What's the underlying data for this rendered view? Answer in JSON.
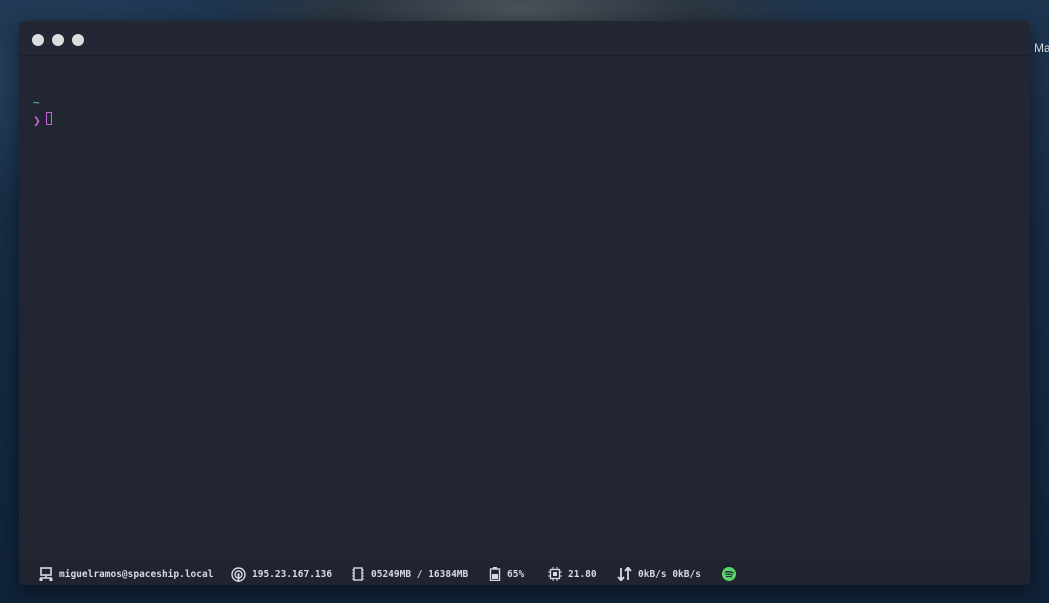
{
  "desktop": {
    "right_edge_label": "Ma"
  },
  "terminal": {
    "cwd": "~",
    "prompt_symbol": "❯"
  },
  "statusbar": {
    "user_host": "miguelramos@spaceship.local",
    "ip": "195.23.167.136",
    "memory": "05249MB / 16384MB",
    "battery": "65%",
    "cpu": "21.80",
    "network": "0kB/s 0kB/s",
    "icons": [
      "network-host-icon",
      "wifi-icon",
      "memory-icon",
      "battery-icon",
      "cpu-icon",
      "transfer-icon",
      "spotify-icon"
    ]
  },
  "colors": {
    "window_bg": "#222633",
    "prompt": "#c465d8",
    "cwd": "#69c3e0",
    "status_text": "#d6dae3",
    "spotify": "#5bd26a"
  }
}
